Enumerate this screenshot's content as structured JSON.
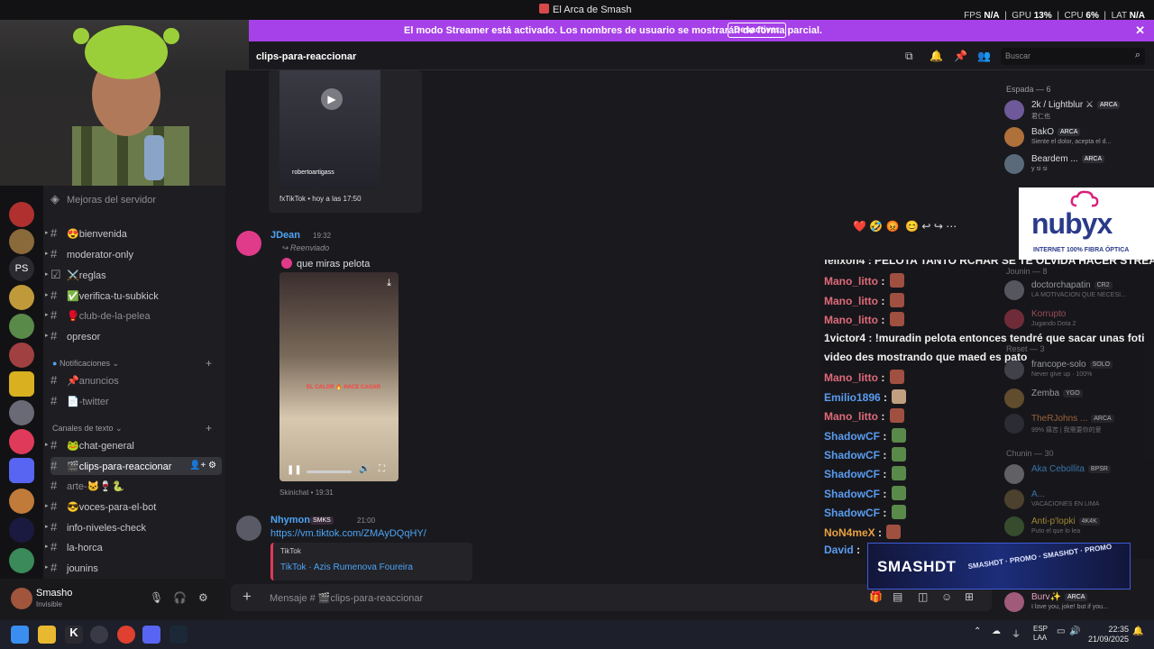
{
  "titlebar": {
    "title": "El Arca de Smash",
    "fps_label": "FPS",
    "fps_value": "N/A",
    "gpu_label": "GPU",
    "gpu_value": "13%",
    "cpu_label": "CPU",
    "cpu_value": "6%",
    "lat_label": "LAT",
    "lat_value": "N/A"
  },
  "banner": {
    "message": "El modo Streamer está activado. Los nombres de usuario se mostrarán de forma parcial.",
    "button": "Desactivar"
  },
  "channel_header": {
    "name": "clips-para-reaccionar",
    "search_placeholder": "Buscar"
  },
  "channels": {
    "boost_label": "Mejoras del servidor",
    "items": [
      {
        "label": "😍bienvenida",
        "muted": false
      },
      {
        "label": "moderator-only",
        "muted": false
      },
      {
        "label": "⚔️reglas",
        "muted": false
      },
      {
        "label": "✅verifica-tu-subkick",
        "muted": false
      },
      {
        "label": "🥊club-de-la-pelea",
        "muted": true
      },
      {
        "label": "opresor",
        "muted": false
      }
    ],
    "cat_notifs": "Notificaciones",
    "notif_items": [
      {
        "label": "📌anuncios",
        "muted": true
      },
      {
        "label": "📄-twitter",
        "muted": true
      }
    ],
    "cat_text": "Canales de texto",
    "text_items": [
      {
        "label": "🐸chat-general",
        "muted": false
      },
      {
        "label": "🎬clips-para-reaccionar",
        "muted": false,
        "active": true
      },
      {
        "label": "arte-🐱🍷🐍",
        "muted": true
      },
      {
        "label": "😎voces-para-el-bot",
        "muted": false
      },
      {
        "label": "info-niveles-check",
        "muted": false
      },
      {
        "label": "la-horca",
        "muted": false
      },
      {
        "label": "jounins",
        "muted": false
      }
    ]
  },
  "user": {
    "name": "Smasho",
    "status": "Invisible"
  },
  "messages": [
    {
      "embed_footer": "fxTikTok • hoy a las 17:50",
      "overlay_handle": "robertoartigass"
    },
    {
      "author": "JDean",
      "time": "19:32",
      "forwarded": "Reenviado",
      "text": "que miras pelota",
      "video_caption": "EL CALOR 🔥 HACE CAGAR",
      "footer": "Skinichat • 19:31"
    },
    {
      "author": "Nhymon",
      "tag": "SMKS",
      "time": "21:00",
      "link": "https://vm.tiktok.com/ZMAyDQqHY/",
      "embed_provider": "TikTok",
      "embed_title": "TikTok · Azis Rumenova Foureira"
    }
  ],
  "composer": {
    "placeholder": "Mensaje # 🎬clips-para-reaccionar"
  },
  "members": {
    "group1": "Espada — 6",
    "group2": "Jounin — 8",
    "group3": "Reset — 3",
    "group4": "Chunin — 30",
    "list": [
      {
        "name": "2k / Lightblur ⚔",
        "tag": "ARCA",
        "sub": "君仁也",
        "color": "#6e5a9a"
      },
      {
        "name": "BakO",
        "tag": "ARCA",
        "sub": "Siente el dolor, acepta el d...",
        "color": "#b0703a"
      },
      {
        "name": "Beardem ...",
        "tag": "ARCA",
        "sub": "y si si",
        "color": "#5a6a7a"
      },
      {
        "name": "doctorchapatin",
        "tag": "CR2",
        "sub": "LA MOTIVACION QUE NECESI...",
        "color": "#7a7a86"
      },
      {
        "name": "Korrupto",
        "tag": "",
        "sub": "Jugando Dota 2",
        "color": "#a03a4a"
      },
      {
        "name": "francope-solo",
        "tag": "SOLO",
        "sub": "Never give up · 100%",
        "color": "#5a5a66"
      },
      {
        "name": "Zemba",
        "tag": "YGO",
        "sub": "",
        "color": "#8a6a3a"
      },
      {
        "name": "TheRJohns ...",
        "tag": "ARCA",
        "sub": "99% 痛苦 | 我需要你的爱",
        "color": "#3a3a46"
      },
      {
        "name": "Aka Cebollita",
        "tag": "BPSR",
        "sub": "",
        "color": "#8a8a90"
      },
      {
        "name": "A...",
        "tag": "",
        "sub": "VACACIONES EN LIMA",
        "color": "#6a5a3a"
      },
      {
        "name": "Anti-p'lopki",
        "tag": "4K4K",
        "sub": "Puto el que lo lea",
        "color": "#4a6a3a"
      },
      {
        "name": "Burv✨",
        "tag": "ARCA",
        "sub": "I love you, joke! but if you...",
        "color": "#a05a7a"
      }
    ]
  },
  "ad": {
    "brand": "nubyx",
    "tagline": "INTERNET 100% FIBRA ÓPTICA"
  },
  "stream_chat": [
    {
      "user": "felixon4",
      "text": "PELOTA TANTO RCHAR SE TE OLVIDA HACER STREAM",
      "color": "#e8e8e8",
      "emote": ""
    },
    {
      "user": "Mano_litto",
      "text": "",
      "color": "#e06a7a",
      "emote": "#a05040"
    },
    {
      "user": "Mano_litto",
      "text": "",
      "color": "#e06a7a",
      "emote": "#a05040"
    },
    {
      "user": "Mano_litto",
      "text": "",
      "color": "#e06a7a",
      "emote": "#a05040"
    },
    {
      "user": "1victor4",
      "text": "!muradin pelota entonces tendré que sacar unas foti",
      "color": "#f0f0f0",
      "emote": ""
    },
    {
      "user": "",
      "text": "video des mostrando que maed es pato",
      "color": "#f0f0f0",
      "emote": ""
    },
    {
      "user": "Mano_litto",
      "text": "",
      "color": "#e06a7a",
      "emote": "#a05040"
    },
    {
      "user": "Emilio1896",
      "text": "",
      "color": "#5a9cf0",
      "emote": "#c0a080"
    },
    {
      "user": "Mano_litto",
      "text": "",
      "color": "#e06a7a",
      "emote": "#a05040"
    },
    {
      "user": "ShadowCF",
      "text": "",
      "color": "#5a9cf0",
      "emote": "#5a8a4a"
    },
    {
      "user": "ShadowCF",
      "text": "",
      "color": "#5a9cf0",
      "emote": "#5a8a4a"
    },
    {
      "user": "ShadowCF",
      "text": "",
      "color": "#5a9cf0",
      "emote": "#5a8a4a"
    },
    {
      "user": "ShadowCF",
      "text": "",
      "color": "#5a9cf0",
      "emote": "#5a8a4a"
    },
    {
      "user": "ShadowCF",
      "text": "",
      "color": "#5a9cf0",
      "emote": "#5a8a4a"
    },
    {
      "user": "NoN4meX",
      "text": "",
      "color": "#e8a040",
      "emote": "#a05040"
    },
    {
      "user": "David",
      "text": "",
      "color": "#5a9cf0",
      "emote": ""
    }
  ],
  "smashdt": {
    "title": "SMASHDT",
    "promo": "SMASHDT · PROMO · SMASHDT · PROMO"
  },
  "taskbar": {
    "lang1": "ESP",
    "lang2": "LAA",
    "time": "22:35",
    "date": "21/09/2025"
  },
  "colors": {
    "accent": "#a640e8",
    "link": "#4ea4f5",
    "banner_bg": "#a640e8"
  }
}
